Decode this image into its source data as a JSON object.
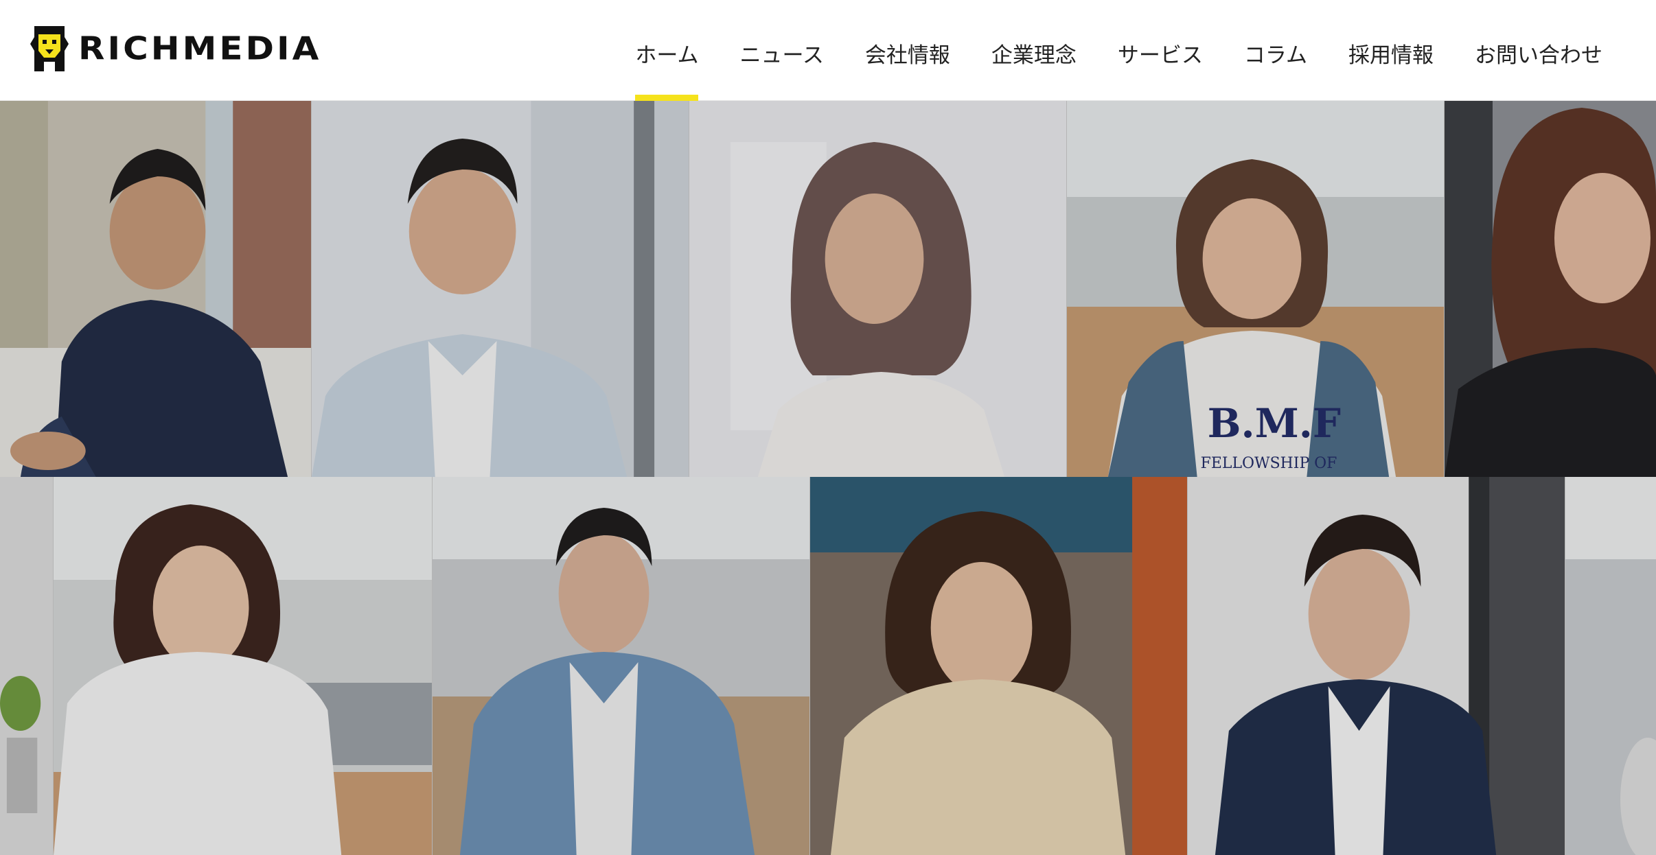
{
  "brand": {
    "name": "RICHMEDIA",
    "logo_icon": "lion-head-icon",
    "accent_color": "#f5e21c"
  },
  "nav": {
    "items": [
      {
        "label": "ホーム",
        "active": true
      },
      {
        "label": "ニュース",
        "active": false
      },
      {
        "label": "会社情報",
        "active": false
      },
      {
        "label": "企業理念",
        "active": false
      },
      {
        "label": "サービス",
        "active": false
      },
      {
        "label": "コラム",
        "active": false
      },
      {
        "label": "採用情報",
        "active": false
      },
      {
        "label": "お問い合わせ",
        "active": false
      }
    ]
  },
  "hero": {
    "photos": [
      {
        "name": "employee-photo-man-navy-shirt"
      },
      {
        "name": "employee-photo-man-vest"
      },
      {
        "name": "employee-photo-woman-white-top"
      },
      {
        "name": "employee-photo-woman-denim-jacket"
      },
      {
        "name": "employee-photo-woman-laughing"
      },
      {
        "name": "employee-photo-woman-white-shirt"
      },
      {
        "name": "employee-photo-man-denim-jacket"
      },
      {
        "name": "employee-photo-woman-beige-sweater"
      },
      {
        "name": "employee-photo-man-navy-blazer"
      }
    ],
    "tshirt_text": "B.M.F FELLOWSHIP OF"
  }
}
